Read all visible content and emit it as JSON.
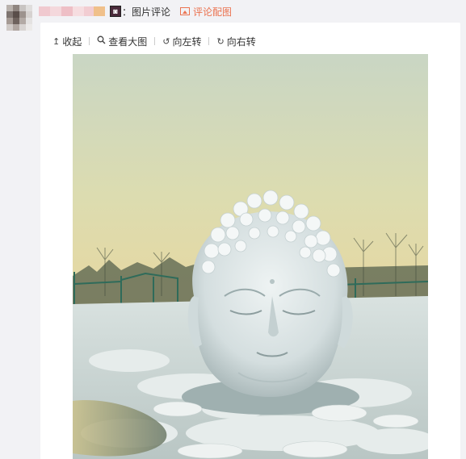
{
  "header": {
    "separator": "：",
    "source_label": "图片评论",
    "comment_link_label": "评论配图"
  },
  "toolbar": {
    "collapse_label": "收起",
    "view_large_label": "查看大图",
    "rotate_left_label": "向左转",
    "rotate_right_label": "向右转"
  },
  "icons": {
    "collapse": "arrow-up-icon",
    "view_large": "magnifier-icon",
    "rotate_left": "rotate-left-icon",
    "rotate_right": "rotate-right-icon",
    "comment_image": "image-icon"
  },
  "colors": {
    "link": "#eb7350",
    "page_bg": "#f2f2f5",
    "card_bg": "#ffffff"
  }
}
